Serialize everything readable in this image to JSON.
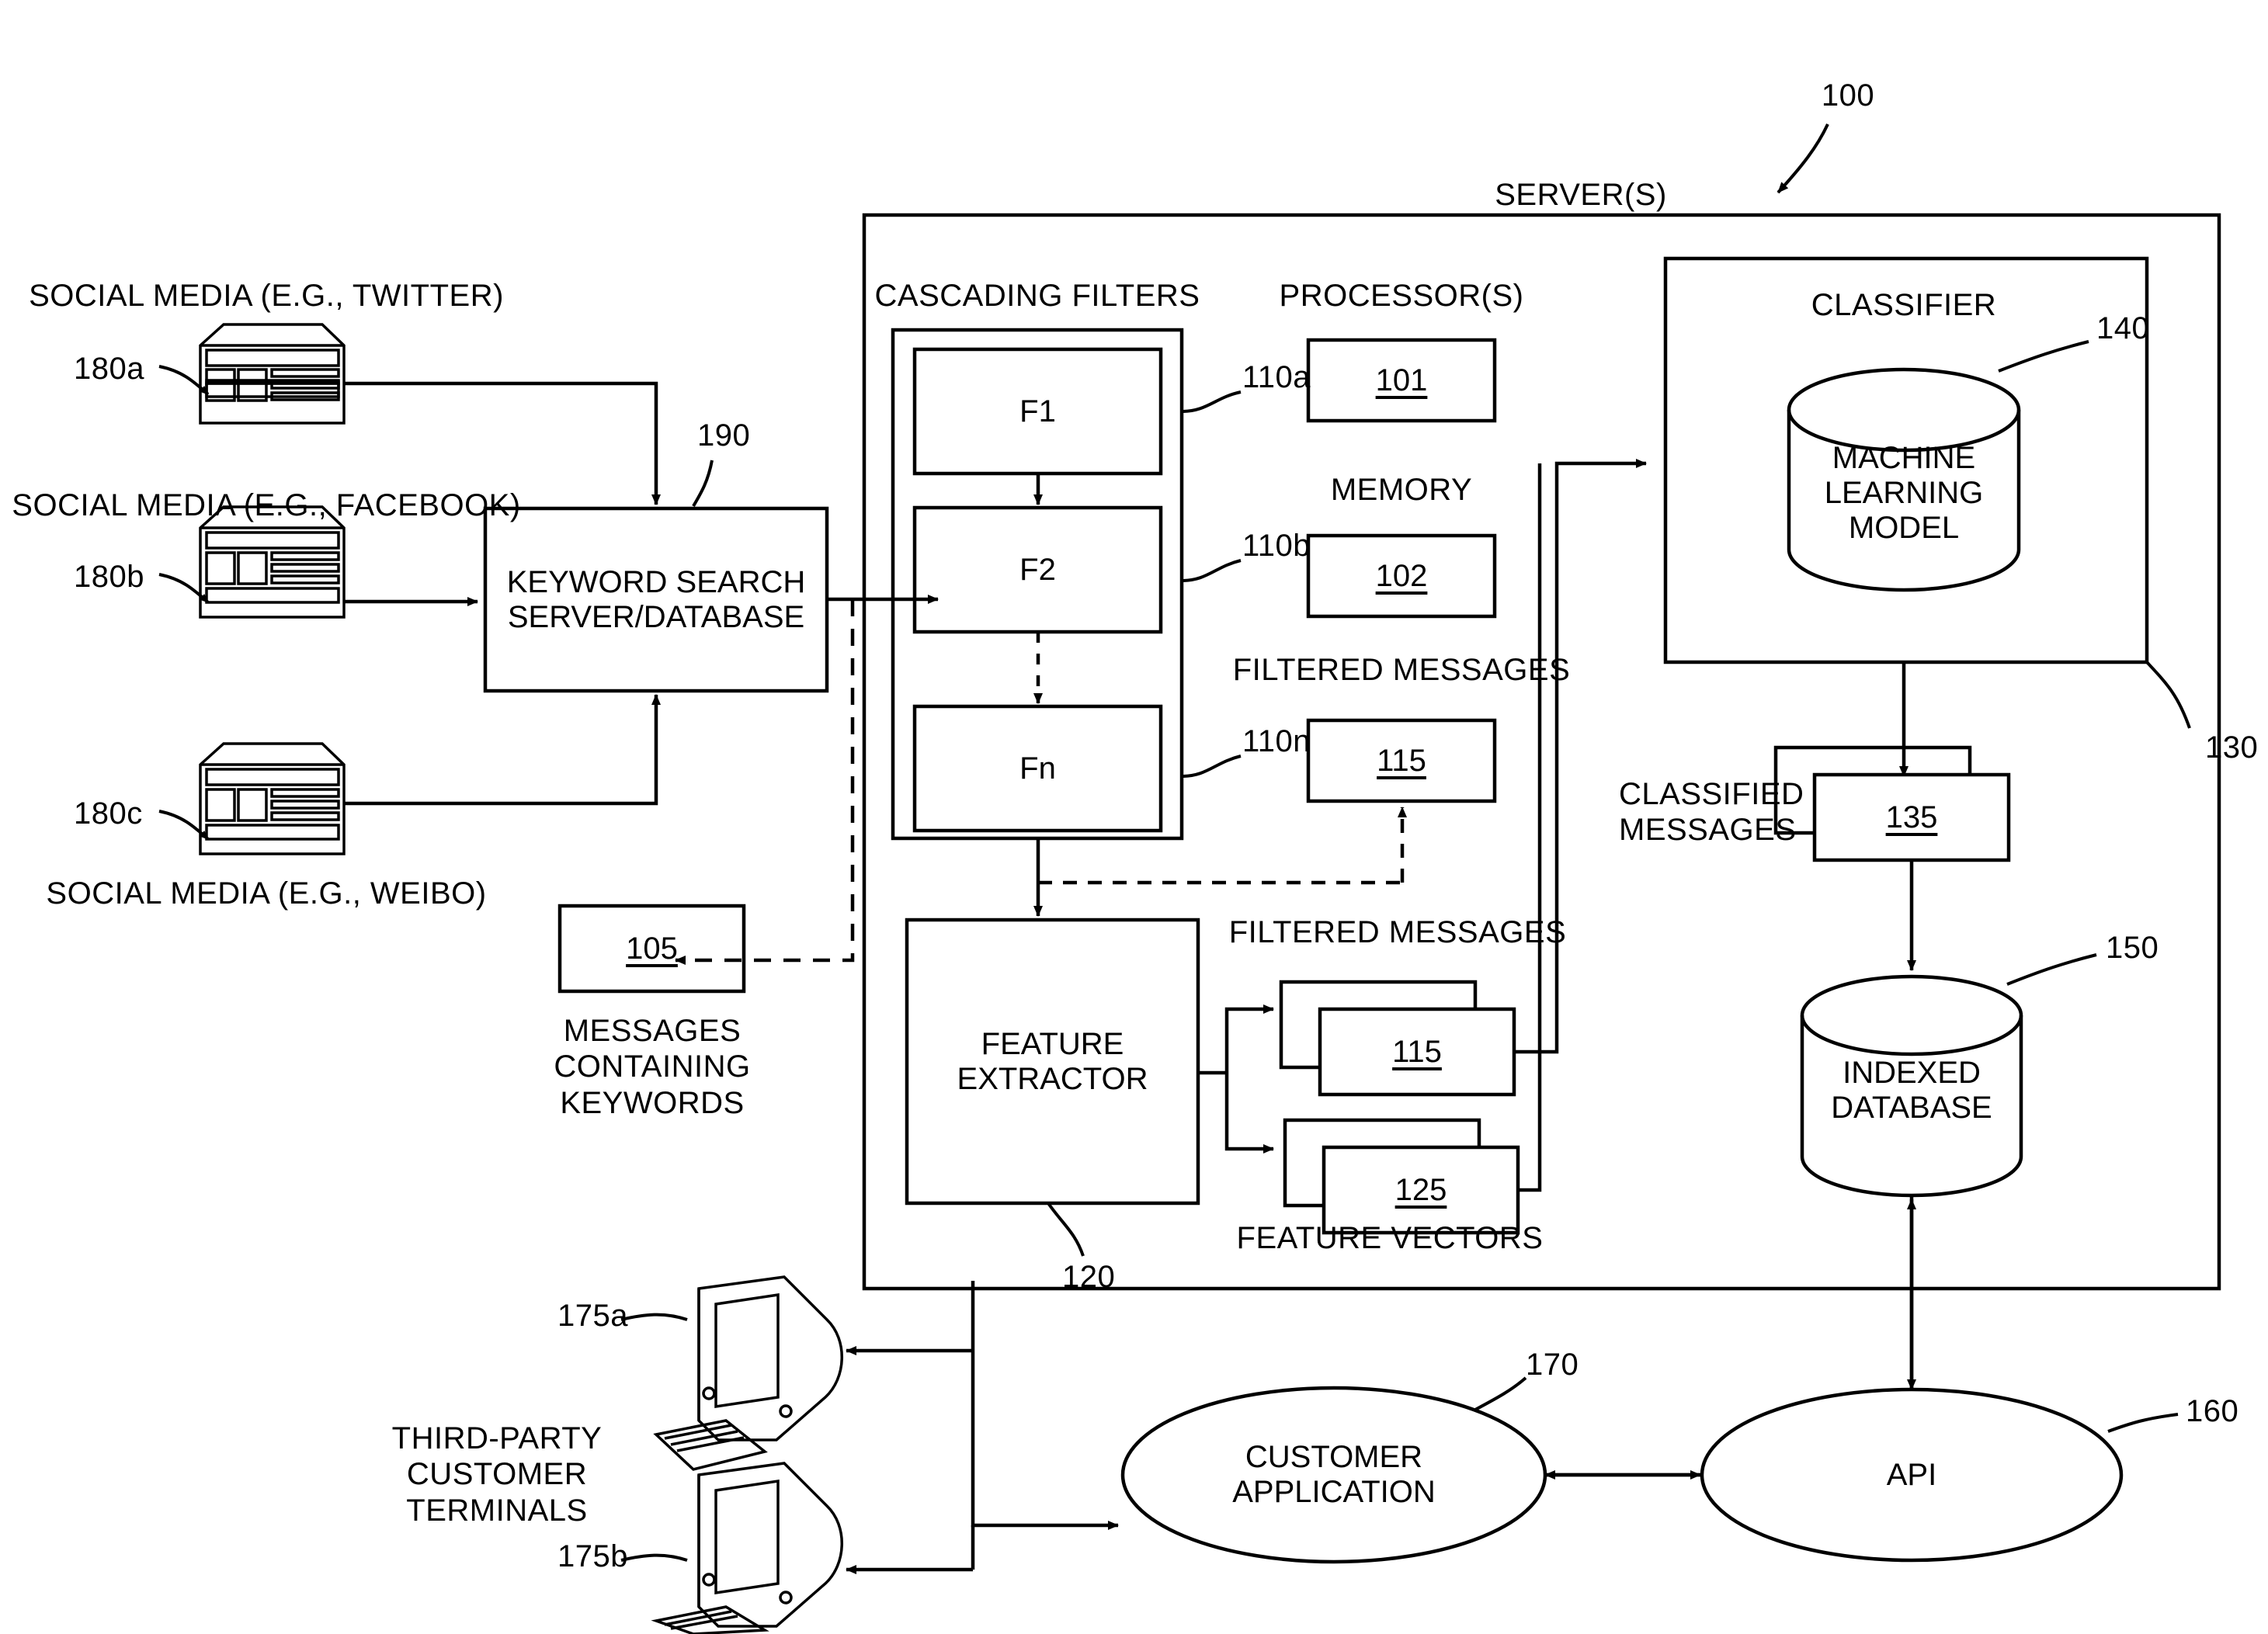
{
  "figure": {
    "system_ref": "100",
    "server_group_label": "SERVER(S)"
  },
  "sources": [
    {
      "id": "180a",
      "label": "SOCIAL MEDIA (E.G., TWITTER)",
      "ref": "180a",
      "icon": "server-rack-icon"
    },
    {
      "id": "180b",
      "label": "SOCIAL MEDIA (E.G., FACEBOOK)",
      "ref": "180b",
      "icon": "server-rack-icon"
    },
    {
      "id": "180c",
      "label": "SOCIAL MEDIA (E.G., WEIBO)",
      "ref": "180c",
      "icon": "server-rack-icon"
    }
  ],
  "keyword_search": {
    "line1": "KEYWORD SEARCH",
    "line2": "SERVER/DATABASE",
    "ref": "190"
  },
  "messages_keywords": {
    "ref_num": "105",
    "caption": "MESSAGES\nCONTAINING\nKEYWORDS"
  },
  "cascading_filters": {
    "title": "CASCADING FILTERS",
    "filters": [
      {
        "label": "F1",
        "ref": "110a"
      },
      {
        "label": "F2",
        "ref": "110b"
      },
      {
        "label": "Fn",
        "ref": "110n"
      }
    ]
  },
  "processors": {
    "title": "PROCESSOR(S)",
    "ref_num": "101"
  },
  "memory": {
    "title": "MEMORY",
    "ref_num": "102"
  },
  "filtered_messages_top": {
    "title": "FILTERED MESSAGES",
    "ref_num": "115"
  },
  "feature_extractor": {
    "line1": "FEATURE",
    "line2": "EXTRACTOR",
    "ref": "120"
  },
  "filtered_messages_mid": {
    "title": "FILTERED MESSAGES",
    "ref_num": "115"
  },
  "feature_vectors": {
    "title": "FEATURE VECTORS",
    "ref_num": "125"
  },
  "classifier": {
    "title": "CLASSIFIER",
    "ref": "130",
    "model": {
      "line1": "MACHINE",
      "line2": "LEARNING",
      "line3": "MODEL",
      "ref": "140"
    }
  },
  "classified_messages": {
    "caption": "CLASSIFIED\nMESSAGES",
    "ref_num": "135"
  },
  "indexed_database": {
    "line1": "INDEXED",
    "line2": "DATABASE",
    "ref": "150"
  },
  "api": {
    "label": "API",
    "ref": "160"
  },
  "customer_application": {
    "line1": "CUSTOMER",
    "line2": "APPLICATION",
    "ref": "170"
  },
  "terminals": {
    "caption": "THIRD-PARTY\nCUSTOMER\nTERMINALS",
    "items": [
      {
        "ref": "175a",
        "icon": "desktop-computer-icon"
      },
      {
        "ref": "175b",
        "icon": "desktop-computer-icon"
      }
    ]
  }
}
